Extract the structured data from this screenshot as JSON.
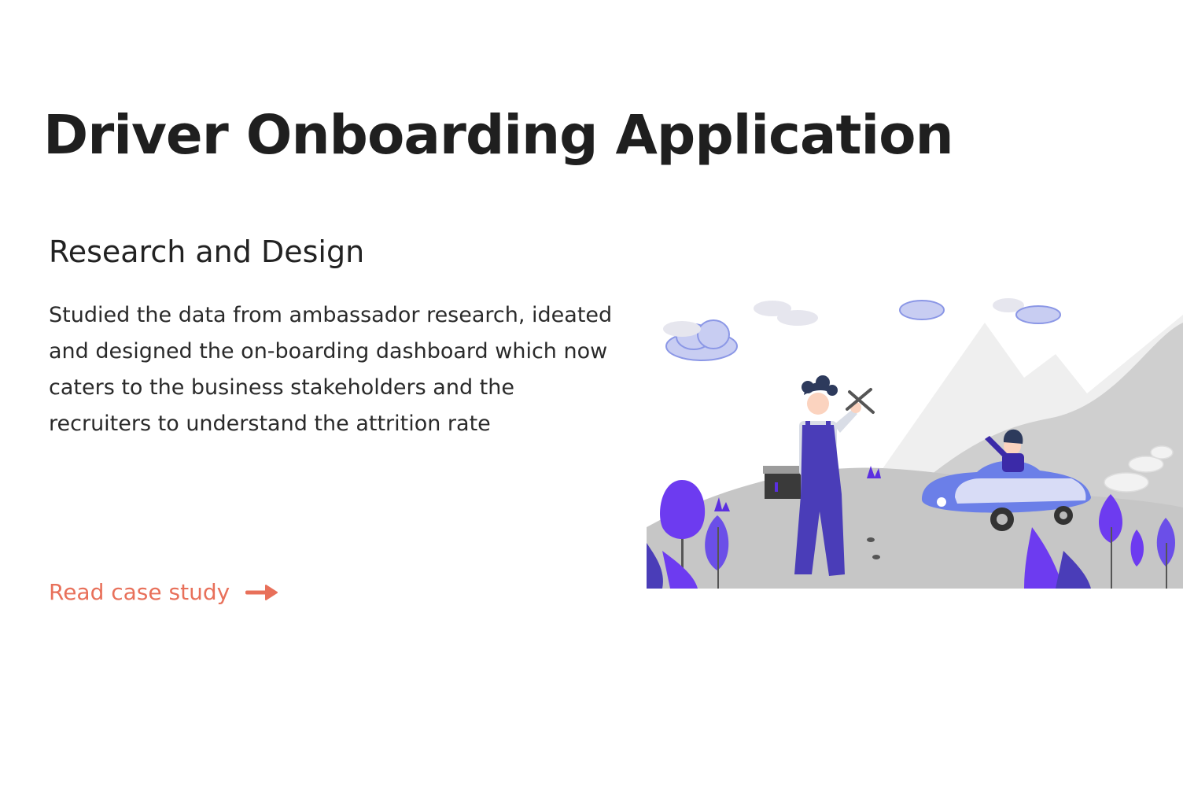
{
  "project": {
    "title": "Driver Onboarding Application",
    "subtitle": "Research and Design",
    "description": "Studied the data from ambassador research, ideated and designed the on-boarding dashboard which now caters to the business stakeholders and the recruiters to understand the attrition rate",
    "cta_label": "Read case study",
    "cta_icon": "arrow-right-icon"
  },
  "colors": {
    "accent": "#e8705a",
    "heading": "#1f1f1f",
    "illustration_purple": "#5b2fe0",
    "illustration_blue": "#6b7fe8",
    "illustration_gray": "#c9c9c9"
  }
}
